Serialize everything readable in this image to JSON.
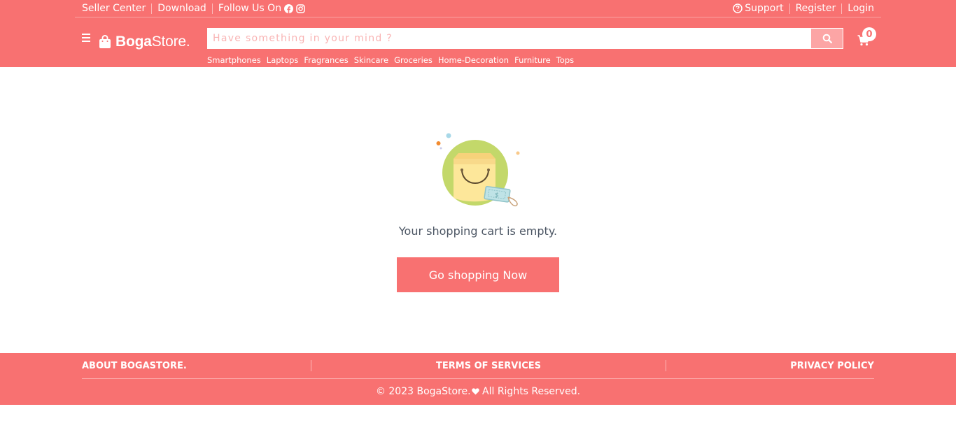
{
  "topbar": {
    "seller_center": "Seller Center",
    "download": "Download",
    "follow_us": "Follow Us On",
    "support": "Support",
    "register": "Register",
    "login": "Login"
  },
  "header": {
    "logo_bold": "Boga",
    "logo_rest": "Store.",
    "search_placeholder": "Have something in your mind ?",
    "search_value": "",
    "cart_count": "0"
  },
  "categories": [
    "Smartphones",
    "Laptops",
    "Fragrances",
    "Skincare",
    "Groceries",
    "Home-Decoration",
    "Furniture",
    "Tops"
  ],
  "main": {
    "empty_text": "Your shopping cart is empty.",
    "cta_label": "Go shopping Now"
  },
  "footer": {
    "about": "ABOUT BOGASTORE.",
    "terms": "TERMS OF SERVICES",
    "privacy": "PRIVACY POLICY",
    "copyright_prefix": "© 2023 BogaStore.",
    "copyright_suffix": " All Rights Reserved."
  },
  "colors": {
    "brand": "#f87171",
    "search_button": "#fca5a5",
    "text_muted": "#4b5563"
  },
  "icons": [
    "menu-icon",
    "shopping-bag-icon",
    "facebook-icon",
    "instagram-icon",
    "help-circle-icon",
    "search-icon",
    "cart-icon",
    "heart-icon",
    "empty-cart-illustration"
  ]
}
